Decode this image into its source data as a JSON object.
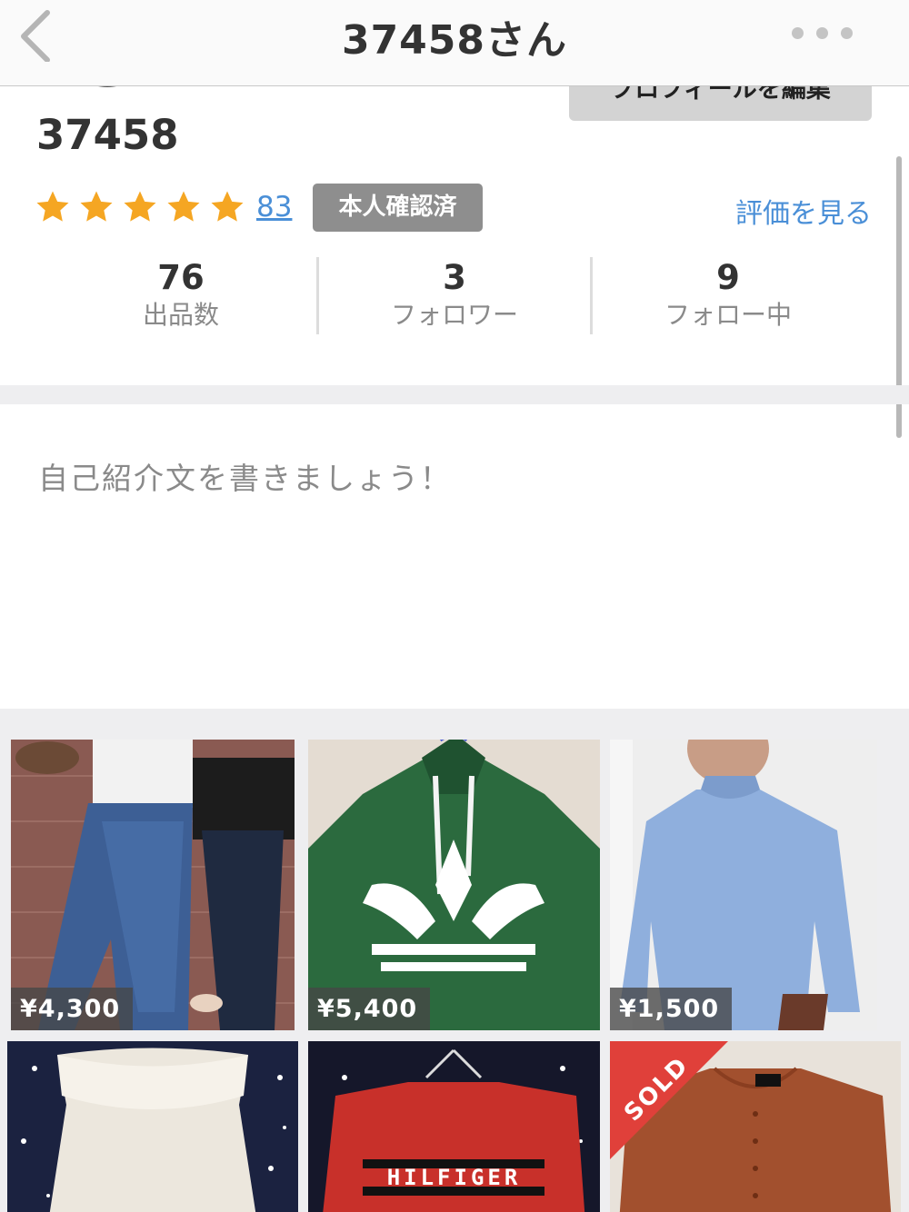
{
  "nav": {
    "title": "37458さん"
  },
  "profile": {
    "edit_button": "プロフィールを編集",
    "username": "37458",
    "rating": 5,
    "rating_count": "83",
    "verified_label": "本人確認済",
    "reviews_link": "評価を見る",
    "bio_placeholder": "自己紹介文を書きましょう！"
  },
  "stats": [
    {
      "value": "76",
      "label": "出品数"
    },
    {
      "value": "3",
      "label": "フォロワー"
    },
    {
      "value": "9",
      "label": "フォロー中"
    }
  ],
  "items": [
    {
      "price": "¥4,300"
    },
    {
      "price": "¥5,400"
    },
    {
      "price": "¥1,500"
    },
    {
      "price": ""
    },
    {
      "price": "",
      "print_text": "HILFIGER"
    },
    {
      "price": "",
      "sold_label": "SOLD"
    }
  ],
  "colors": {
    "accent_link": "#4a8fd7",
    "star": "#f5a623",
    "sold": "#e0403a"
  }
}
